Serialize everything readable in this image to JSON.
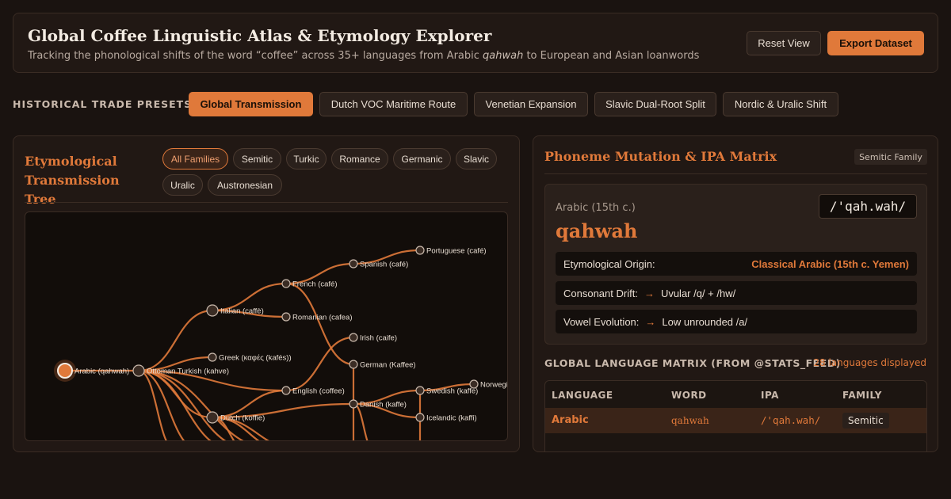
{
  "header": {
    "title": "Global Coffee Linguistic Atlas & Etymology Explorer",
    "subtitle_pre": "Tracking the phonological shifts of the word “coffee” across 35+ languages from Arabic ",
    "subtitle_em": "qahwah",
    "subtitle_post": " to European and Asian loanwords",
    "reset_label": "Reset View",
    "export_label": "Export Dataset"
  },
  "presets": {
    "label": "HISTORICAL TRADE PRESETS:",
    "items": [
      "Global Transmission",
      "Dutch VOC Maritime Route",
      "Venetian Expansion",
      "Slavic Dual-Root Split",
      "Nordic & Uralic Shift"
    ],
    "active": "Global Transmission"
  },
  "tree_panel": {
    "title": "Etymological Transmission Tree",
    "filters": [
      "All Families",
      "Semitic",
      "Turkic",
      "Romance",
      "Germanic",
      "Slavic",
      "Uralic",
      "Austronesian"
    ],
    "active_filter": "All Families",
    "nodes": [
      {
        "id": "arabic",
        "label": "Arabic (qahwah)"
      },
      {
        "id": "ottoman",
        "label": "Ottoman Turkish (kahve)"
      },
      {
        "id": "italian",
        "label": "Italian (caffè)"
      },
      {
        "id": "greek",
        "label": "Greek (καφές (kafés))"
      },
      {
        "id": "dutch",
        "label": "Dutch (koffie)"
      },
      {
        "id": "french",
        "label": "French (café)"
      },
      {
        "id": "romanian",
        "label": "Romanian (cafea)"
      },
      {
        "id": "english",
        "label": "English (coffee)"
      },
      {
        "id": "german",
        "label": "German (Kaffee)"
      },
      {
        "id": "danish",
        "label": "Danish (kaffe)"
      },
      {
        "id": "spanish",
        "label": "Spanish (café)"
      },
      {
        "id": "irish",
        "label": "Irish (caife)"
      },
      {
        "id": "portuguese",
        "label": "Portuguese (café)"
      },
      {
        "id": "swedish",
        "label": "Swedish (kaffe)"
      },
      {
        "id": "icelandic",
        "label": "Icelandic (kaffi)"
      },
      {
        "id": "norwegian",
        "label": "Norwegian (kaffe)"
      }
    ]
  },
  "matrix_panel": {
    "title": "Phoneme Mutation & IPA Matrix",
    "family_badge": "Semitic Family",
    "era": "Arabic (15th c.)",
    "word": "qahwah",
    "ipa": "/'qah.wah/",
    "origin_label": "Etymological Origin:",
    "origin_value": "Classical Arabic (15th c. Yemen)",
    "consonant_label": "Consonant Drift:",
    "consonant_value": "Uvular /q/ + /hw/",
    "vowel_label": "Vowel Evolution:",
    "vowel_value": "Low unrounded /a/",
    "global_label": "GLOBAL LANGUAGE MATRIX (FROM @STATS_FEED)",
    "global_count": "28 languages displayed",
    "table_headers": [
      "LANGUAGE",
      "WORD",
      "IPA",
      "FAMILY"
    ],
    "rows": [
      {
        "language": "Arabic",
        "word": "qahwah",
        "ipa": "/'qah.wah/",
        "family": "Semitic"
      }
    ]
  },
  "colors": {
    "accent": "#e0793a",
    "background": "#1a1310",
    "panel": "#211814"
  }
}
